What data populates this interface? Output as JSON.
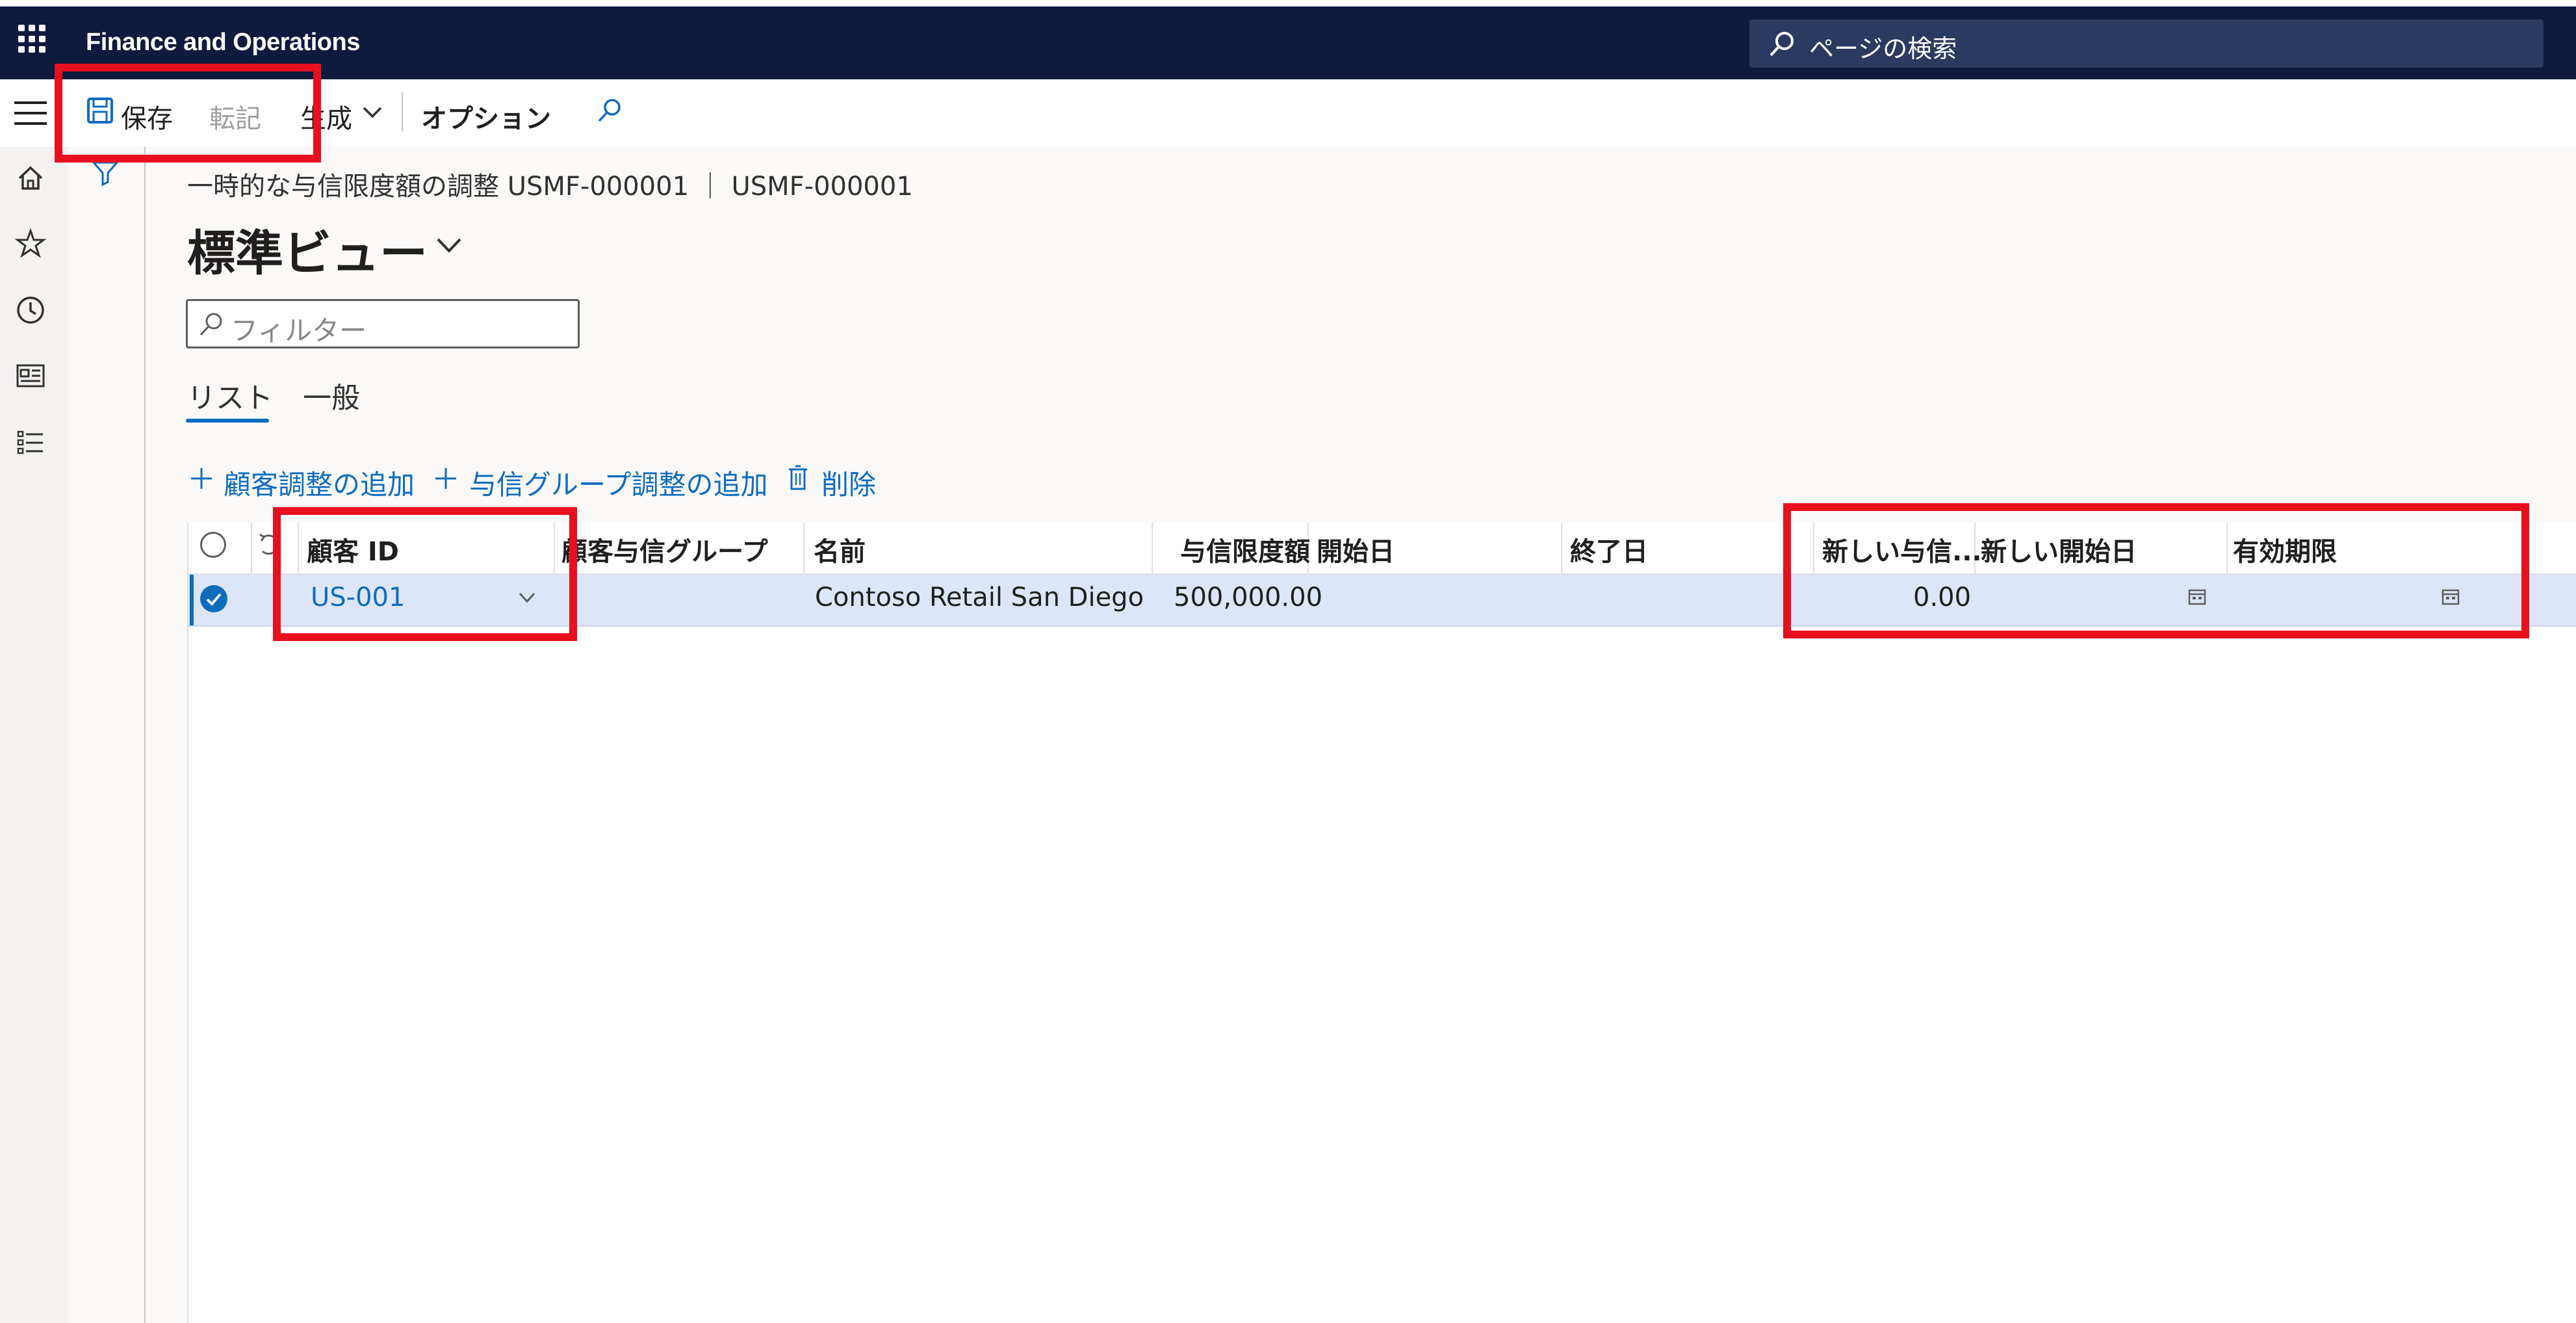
{
  "app": {
    "title": "Finance and Operations",
    "search_placeholder": "ページの検索"
  },
  "actionbar": {
    "save_label": "保存",
    "post_label": "転記",
    "generate_label": "生成",
    "options_label": "オプション"
  },
  "page": {
    "breadcrumb": "一時的な与信限度額の調整 USMF-000001 ｜ USMF-000001",
    "title": "標準ビュー",
    "filter_placeholder": "フィルター",
    "tabs": [
      "リスト",
      "一般"
    ]
  },
  "grid_actions": {
    "add_customer": "顧客調整の追加",
    "add_credit_group": "与信グループ調整の追加",
    "delete": "削除"
  },
  "grid": {
    "columns": [
      "顧客 ID",
      "顧客与信グループ",
      "名前",
      "与信限度額",
      "開始日",
      "終了日",
      "新しい与信...",
      "新しい開始日",
      "有効期限"
    ],
    "rows": [
      {
        "customer_id": "US-001",
        "credit_group": "",
        "name": "Contoso Retail San Diego",
        "credit_limit": "500,000.00",
        "start_date": "",
        "end_date": "",
        "new_credit_limit": "0.00",
        "new_start_date": "",
        "expiration": ""
      }
    ]
  },
  "colors": {
    "topbar": "#0e1a3e",
    "accent": "#0f6cbd",
    "highlight": "#e8101e",
    "selected_row": "#dde6f8"
  }
}
